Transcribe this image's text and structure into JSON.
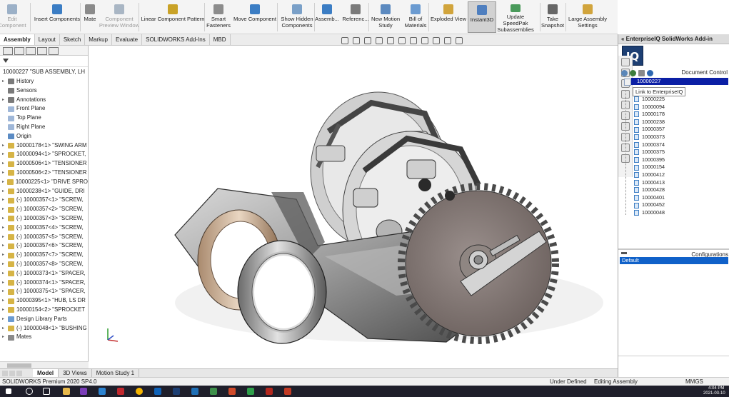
{
  "ribbon": {
    "items": [
      {
        "label": "Edit\nComponent",
        "disabled": true,
        "color": "#9bb0c7"
      },
      {
        "label": "Insert Components",
        "disabled": false,
        "color": "#3b7dc4"
      },
      {
        "label": "Mate",
        "disabled": false,
        "color": "#8a8a8a"
      },
      {
        "label": "Component\nPreview Window",
        "disabled": true,
        "color": "#a9b6c4"
      },
      {
        "label": "Linear Component Pattern",
        "disabled": false,
        "color": "#c9a227"
      },
      {
        "label": "Smart\nFasteners",
        "disabled": false,
        "color": "#8c8c8c"
      },
      {
        "label": "Move Component",
        "disabled": false,
        "color": "#3b7dc4"
      },
      {
        "label": "Show Hidden\nComponents",
        "disabled": false,
        "color": "#7aa0c8"
      },
      {
        "label": "Assemb...",
        "disabled": false,
        "color": "#3b7dc4"
      },
      {
        "label": "Referenc...",
        "disabled": false,
        "color": "#7a7a7a"
      },
      {
        "label": "New Motion\nStudy",
        "disabled": false,
        "color": "#5c8ac0"
      },
      {
        "label": "Bill of\nMaterials",
        "disabled": false,
        "color": "#6b9bd1"
      },
      {
        "label": "Exploded View",
        "disabled": false,
        "color": "#d1a43c"
      },
      {
        "label": "Instant3D",
        "disabled": false,
        "active": true,
        "color": "#4f7fbf"
      },
      {
        "label": "Update SpeedPak\nSubassemblies",
        "disabled": false,
        "color": "#4a9a5b"
      },
      {
        "label": "Take\nSnapshot",
        "disabled": false,
        "color": "#666666"
      },
      {
        "label": "Large Assembly\nSettings",
        "disabled": false,
        "color": "#d1a43c"
      }
    ]
  },
  "cm_tabs": [
    "Assembly",
    "Layout",
    "Sketch",
    "Markup",
    "Evaluate",
    "SOLIDWORKS Add-Ins",
    "MBD"
  ],
  "feature_tree": {
    "root": "10000227 \"SUB ASSEMBLY, LH",
    "items": [
      {
        "label": "History",
        "exp": "▸",
        "color": "#7a7a7a"
      },
      {
        "label": "Sensors",
        "exp": "",
        "color": "#7a7a7a"
      },
      {
        "label": "Annotations",
        "exp": "▸",
        "color": "#7a7a7a"
      },
      {
        "label": "Front Plane",
        "exp": "",
        "color": "#9fb7d8"
      },
      {
        "label": "Top Plane",
        "exp": "",
        "color": "#9fb7d8"
      },
      {
        "label": "Right Plane",
        "exp": "",
        "color": "#9fb7d8"
      },
      {
        "label": "Origin",
        "exp": "",
        "color": "#5b8bc4"
      },
      {
        "label": "10000178<1> \"SWING ARM",
        "exp": "▸",
        "color": "#d6b446"
      },
      {
        "label": "10000094<1> \"SPROCKET,",
        "exp": "▸",
        "color": "#d6b446"
      },
      {
        "label": "10000506<1> \"TENSIONER",
        "exp": "▸",
        "color": "#d6b446"
      },
      {
        "label": "10000506<2> \"TENSIONER",
        "exp": "▸",
        "color": "#d6b446"
      },
      {
        "label": "10000225<1> \"DRIVE SPRO",
        "exp": "▸",
        "color": "#d6b446"
      },
      {
        "label": "10000238<1> \"GUIDE, DRI",
        "exp": "▸",
        "color": "#d6b446"
      },
      {
        "label": "(-) 10000357<1> \"SCREW,",
        "exp": "▸",
        "color": "#d6b446"
      },
      {
        "label": "(-) 10000357<2> \"SCREW,",
        "exp": "▸",
        "color": "#d6b446"
      },
      {
        "label": "(-) 10000357<3> \"SCREW,",
        "exp": "▸",
        "color": "#d6b446"
      },
      {
        "label": "(-) 10000357<4> \"SCREW,",
        "exp": "▸",
        "color": "#d6b446"
      },
      {
        "label": "(-) 10000357<5> \"SCREW,",
        "exp": "▸",
        "color": "#d6b446"
      },
      {
        "label": "(-) 10000357<6> \"SCREW,",
        "exp": "▸",
        "color": "#d6b446"
      },
      {
        "label": "(-) 10000357<7> \"SCREW,",
        "exp": "▸",
        "color": "#d6b446"
      },
      {
        "label": "(-) 10000357<8> \"SCREW,",
        "exp": "▸",
        "color": "#d6b446"
      },
      {
        "label": "(-) 10000373<1> \"SPACER,",
        "exp": "▸",
        "color": "#d6b446"
      },
      {
        "label": "(-) 10000374<1> \"SPACER,",
        "exp": "▸",
        "color": "#d6b446"
      },
      {
        "label": "(-) 10000375<1> \"SPACER,",
        "exp": "▸",
        "color": "#d6b446"
      },
      {
        "label": "10000395<1> \"HUB, LS DR",
        "exp": "▸",
        "color": "#d6b446"
      },
      {
        "label": "10000154<2> \"SPROCKET",
        "exp": "▸",
        "color": "#d6b446"
      },
      {
        "label": "Design Library Parts",
        "exp": "▸",
        "color": "#6b9bd1"
      },
      {
        "label": "(-) 10000048<1> \"BUSHING",
        "exp": "▸",
        "color": "#d6b446"
      },
      {
        "label": "Mates",
        "exp": "▸",
        "color": "#8a8a8a"
      }
    ]
  },
  "bottom_tabs": [
    "Model",
    "3D Views",
    "Motion Study 1"
  ],
  "status": {
    "product": "SOLIDWORKS Premium 2020 SP4.0",
    "definition": "Under Defined",
    "mode": "Editing Assembly",
    "units": "MMGS"
  },
  "taskbar": {
    "time": "4:04 PM",
    "date": "2021-03-10"
  },
  "right_panel": {
    "title": "EnterpriseIQ SolidWorks Add-in",
    "logo": "IQ",
    "doc_control_title": "Document Control",
    "root_item": "10000227",
    "tooltip": "Link to EnterpriseIQ",
    "items": [
      "10000225",
      "10000094",
      "10000178",
      "10000238",
      "10000357",
      "10000373",
      "10000374",
      "10000375",
      "10000395",
      "10000154",
      "10000412",
      "10000413",
      "10000428",
      "10000401",
      "10000452",
      "10000048"
    ],
    "configurations_title": "Configurations",
    "config_selected": "Default"
  }
}
